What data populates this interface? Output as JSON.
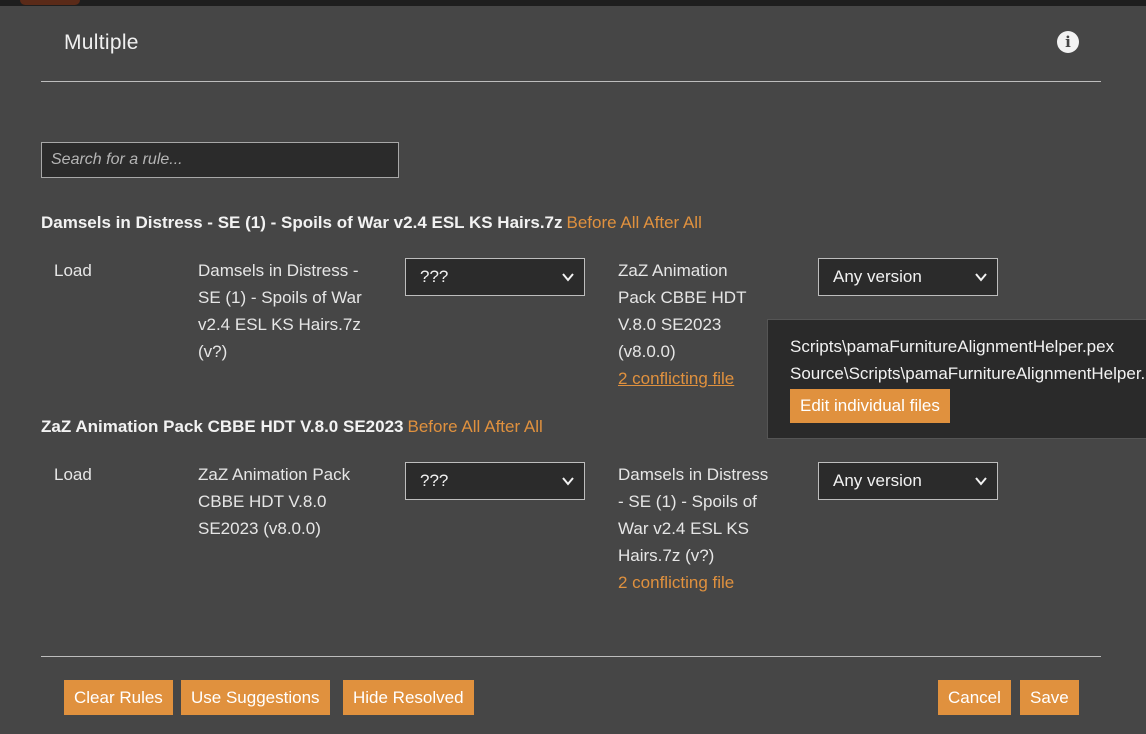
{
  "modal": {
    "title": "Multiple",
    "info_icon": "info-circle-icon"
  },
  "search": {
    "placeholder": "Search for a rule...",
    "value": ""
  },
  "groups": [
    {
      "name": "Damsels in Distress - SE (1) - Spoils of War v2.4 ESL KS Hairs.7z",
      "before_all": "Before All",
      "after_all": "After All",
      "rule": {
        "type": "Load",
        "source_mod": [
          "Damsels in Distress -",
          "SE (1) - Spoils of War",
          "v2.4 ESL KS Hairs.7z",
          "(v?)"
        ],
        "relation": "???",
        "target_mod": [
          "ZaZ Animation",
          "Pack CBBE HDT",
          "V.8.0 SE2023",
          "(v8.0.0)"
        ],
        "conflicts": "2 conflicting file",
        "version": "Any version"
      }
    },
    {
      "name": "ZaZ Animation Pack CBBE HDT V.8.0 SE2023",
      "before_all": "Before All",
      "after_all": "After All",
      "rule": {
        "type": "Load",
        "source_mod": [
          "ZaZ Animation Pack",
          "CBBE HDT V.8.0",
          "SE2023 (v8.0.0)"
        ],
        "relation": "???",
        "target_mod": [
          "Damsels in Distress",
          "- SE (1) - Spoils of",
          "War v2.4 ESL KS",
          "Hairs.7z (v?)"
        ],
        "conflicts": "2 conflicting file",
        "version": "Any version"
      }
    }
  ],
  "tooltip": {
    "files": [
      "Scripts\\pamaFurnitureAlignmentHelper.pex",
      "Source\\Scripts\\pamaFurnitureAlignmentHelper.psc"
    ],
    "edit_button": "Edit individual files"
  },
  "footer": {
    "clear_rules": "Clear Rules",
    "use_suggestions": "Use Suggestions",
    "hide_resolved": "Hide Resolved",
    "cancel": "Cancel",
    "save": "Save"
  }
}
